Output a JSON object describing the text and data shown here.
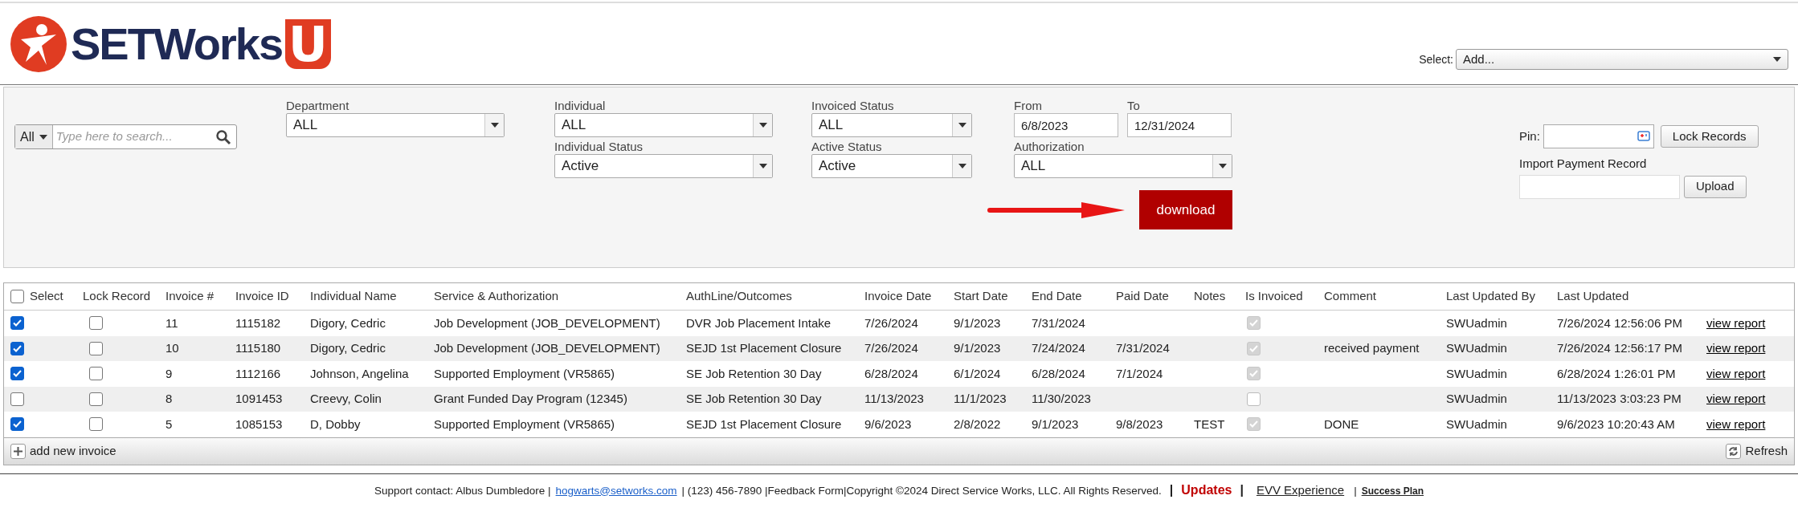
{
  "header": {
    "logo": {
      "text": "SETWorks",
      "accent": "U"
    },
    "select": {
      "label": "Select:",
      "value": "Add..."
    }
  },
  "filters": {
    "search": {
      "scope": "All",
      "placeholder": "Type here to search..."
    },
    "department": {
      "label": "Department",
      "value": "ALL"
    },
    "individual": {
      "label": "Individual",
      "value": "ALL"
    },
    "individual_status": {
      "label": "Individual Status",
      "value": "Active"
    },
    "invoiced_status": {
      "label": "Invoiced Status",
      "value": "ALL"
    },
    "active_status": {
      "label": "Active Status",
      "value": "Active"
    },
    "from": {
      "label": "From",
      "value": "6/8/2023"
    },
    "to": {
      "label": "To",
      "value": "12/31/2024"
    },
    "authorization": {
      "label": "Authorization",
      "value": "ALL"
    },
    "download_button": "download",
    "pin": {
      "label": "Pin:"
    },
    "lock_button": "Lock Records",
    "import": {
      "label": "Import Payment Record"
    },
    "upload_button": "Upload"
  },
  "table": {
    "select_all": {
      "checked": false
    },
    "columns": [
      "Select",
      "Lock Record",
      "Invoice #",
      "Invoice ID",
      "Individual Name",
      "Service & Authorization",
      "AuthLine/Outcomes",
      "Invoice Date",
      "Start Date",
      "End Date",
      "Paid Date",
      "Notes",
      "Is Invoiced",
      "Comment",
      "Last Updated By",
      "Last Updated"
    ],
    "rows": [
      {
        "cells": [
          {
            "kind": "check",
            "checked": true
          },
          {
            "kind": "check",
            "checked": false
          },
          {
            "kind": "text",
            "text": "11"
          },
          {
            "kind": "text",
            "text": "1115182"
          },
          {
            "kind": "text",
            "text": "Digory, Cedric"
          },
          {
            "kind": "text",
            "text": "Job Development (JOB_DEVELOPMENT)"
          },
          {
            "kind": "text",
            "text": "DVR Job Placement Intake"
          },
          {
            "kind": "text",
            "text": "7/26/2024"
          },
          {
            "kind": "text",
            "text": "9/1/2023"
          },
          {
            "kind": "text",
            "text": "7/31/2024"
          },
          {
            "kind": "text",
            "text": ""
          },
          {
            "kind": "text",
            "text": ""
          },
          {
            "kind": "readonly-check",
            "checked": true
          },
          {
            "kind": "text",
            "text": ""
          },
          {
            "kind": "text",
            "text": "SWUadmin"
          },
          {
            "kind": "text",
            "text": "7/26/2024 12:56:06 PM"
          },
          {
            "kind": "link",
            "text": "view report"
          }
        ]
      },
      {
        "cells": [
          {
            "kind": "check",
            "checked": true
          },
          {
            "kind": "check",
            "checked": false
          },
          {
            "kind": "text",
            "text": "10"
          },
          {
            "kind": "text",
            "text": "1115180"
          },
          {
            "kind": "text",
            "text": "Digory, Cedric"
          },
          {
            "kind": "text",
            "text": "Job Development (JOB_DEVELOPMENT)"
          },
          {
            "kind": "text",
            "text": "SEJD 1st Placement Closure"
          },
          {
            "kind": "text",
            "text": "7/26/2024"
          },
          {
            "kind": "text",
            "text": "9/1/2023"
          },
          {
            "kind": "text",
            "text": "7/24/2024"
          },
          {
            "kind": "text",
            "text": "7/31/2024"
          },
          {
            "kind": "text",
            "text": ""
          },
          {
            "kind": "readonly-check",
            "checked": true
          },
          {
            "kind": "text",
            "text": "received payment"
          },
          {
            "kind": "text",
            "text": "SWUadmin"
          },
          {
            "kind": "text",
            "text": "7/26/2024 12:56:17 PM"
          },
          {
            "kind": "link",
            "text": "view report"
          }
        ]
      },
      {
        "cells": [
          {
            "kind": "check",
            "checked": true
          },
          {
            "kind": "check",
            "checked": false
          },
          {
            "kind": "text",
            "text": "9"
          },
          {
            "kind": "text",
            "text": "1112166"
          },
          {
            "kind": "text",
            "text": "Johnson, Angelina"
          },
          {
            "kind": "text",
            "text": "Supported Employment (VR5865)"
          },
          {
            "kind": "text",
            "text": "SE Job Retention 30 Day"
          },
          {
            "kind": "text",
            "text": "6/28/2024"
          },
          {
            "kind": "text",
            "text": "6/1/2024"
          },
          {
            "kind": "text",
            "text": "6/28/2024"
          },
          {
            "kind": "text",
            "text": "7/1/2024"
          },
          {
            "kind": "text",
            "text": ""
          },
          {
            "kind": "readonly-check",
            "checked": true
          },
          {
            "kind": "text",
            "text": ""
          },
          {
            "kind": "text",
            "text": "SWUadmin"
          },
          {
            "kind": "text",
            "text": "6/28/2024 1:26:01 PM"
          },
          {
            "kind": "link",
            "text": "view report"
          }
        ]
      },
      {
        "cells": [
          {
            "kind": "check",
            "checked": false
          },
          {
            "kind": "check",
            "checked": false
          },
          {
            "kind": "text",
            "text": "8"
          },
          {
            "kind": "text",
            "text": "1091453"
          },
          {
            "kind": "text",
            "text": "Creevy, Colin"
          },
          {
            "kind": "text",
            "text": "Grant Funded Day Program (12345)"
          },
          {
            "kind": "text",
            "text": "SE Job Retention 30 Day"
          },
          {
            "kind": "text",
            "text": "11/13/2023"
          },
          {
            "kind": "text",
            "text": "11/1/2023"
          },
          {
            "kind": "text",
            "text": "11/30/2023"
          },
          {
            "kind": "text",
            "text": ""
          },
          {
            "kind": "text",
            "text": ""
          },
          {
            "kind": "readonly-check",
            "checked": false
          },
          {
            "kind": "text",
            "text": ""
          },
          {
            "kind": "text",
            "text": "SWUadmin"
          },
          {
            "kind": "text",
            "text": "11/13/2023 3:03:23 PM"
          },
          {
            "kind": "link",
            "text": "view report"
          }
        ]
      },
      {
        "cells": [
          {
            "kind": "check",
            "checked": true
          },
          {
            "kind": "check",
            "checked": false
          },
          {
            "kind": "text",
            "text": "5"
          },
          {
            "kind": "text",
            "text": "1085153"
          },
          {
            "kind": "text",
            "text": "D, Dobby"
          },
          {
            "kind": "text",
            "text": "Supported Employment (VR5865)"
          },
          {
            "kind": "text",
            "text": "SEJD 1st Placement Closure"
          },
          {
            "kind": "text",
            "text": "9/6/2023"
          },
          {
            "kind": "text",
            "text": "2/8/2022"
          },
          {
            "kind": "text",
            "text": "9/1/2023"
          },
          {
            "kind": "text",
            "text": "9/8/2023"
          },
          {
            "kind": "text",
            "text": "TEST"
          },
          {
            "kind": "readonly-check",
            "checked": true
          },
          {
            "kind": "text",
            "text": "DONE"
          },
          {
            "kind": "text",
            "text": "SWUadmin"
          },
          {
            "kind": "text",
            "text": "9/6/2023 10:20:43 AM"
          },
          {
            "kind": "link",
            "text": "view report"
          }
        ]
      }
    ],
    "add_button": "add new invoice",
    "refresh_button": "Refresh"
  },
  "footer": [
    {
      "kind": "text",
      "text": "Support contact: Albus Dumbledore |"
    },
    {
      "kind": "email",
      "text": "hogwarts@setworks.com"
    },
    {
      "kind": "text",
      "text": "| (123) 456-7890 |Feedback Form|Copyright ©2024 Direct Service Works, LLC. All Rights Reserved."
    },
    {
      "kind": "separator",
      "text": "|"
    },
    {
      "kind": "updates",
      "text": "Updates"
    },
    {
      "kind": "separator",
      "text": "|"
    },
    {
      "kind": "link",
      "text": "EVV Experience"
    },
    {
      "kind": "text",
      "text": "|"
    },
    {
      "kind": "small-link",
      "text": "Success Plan"
    }
  ]
}
